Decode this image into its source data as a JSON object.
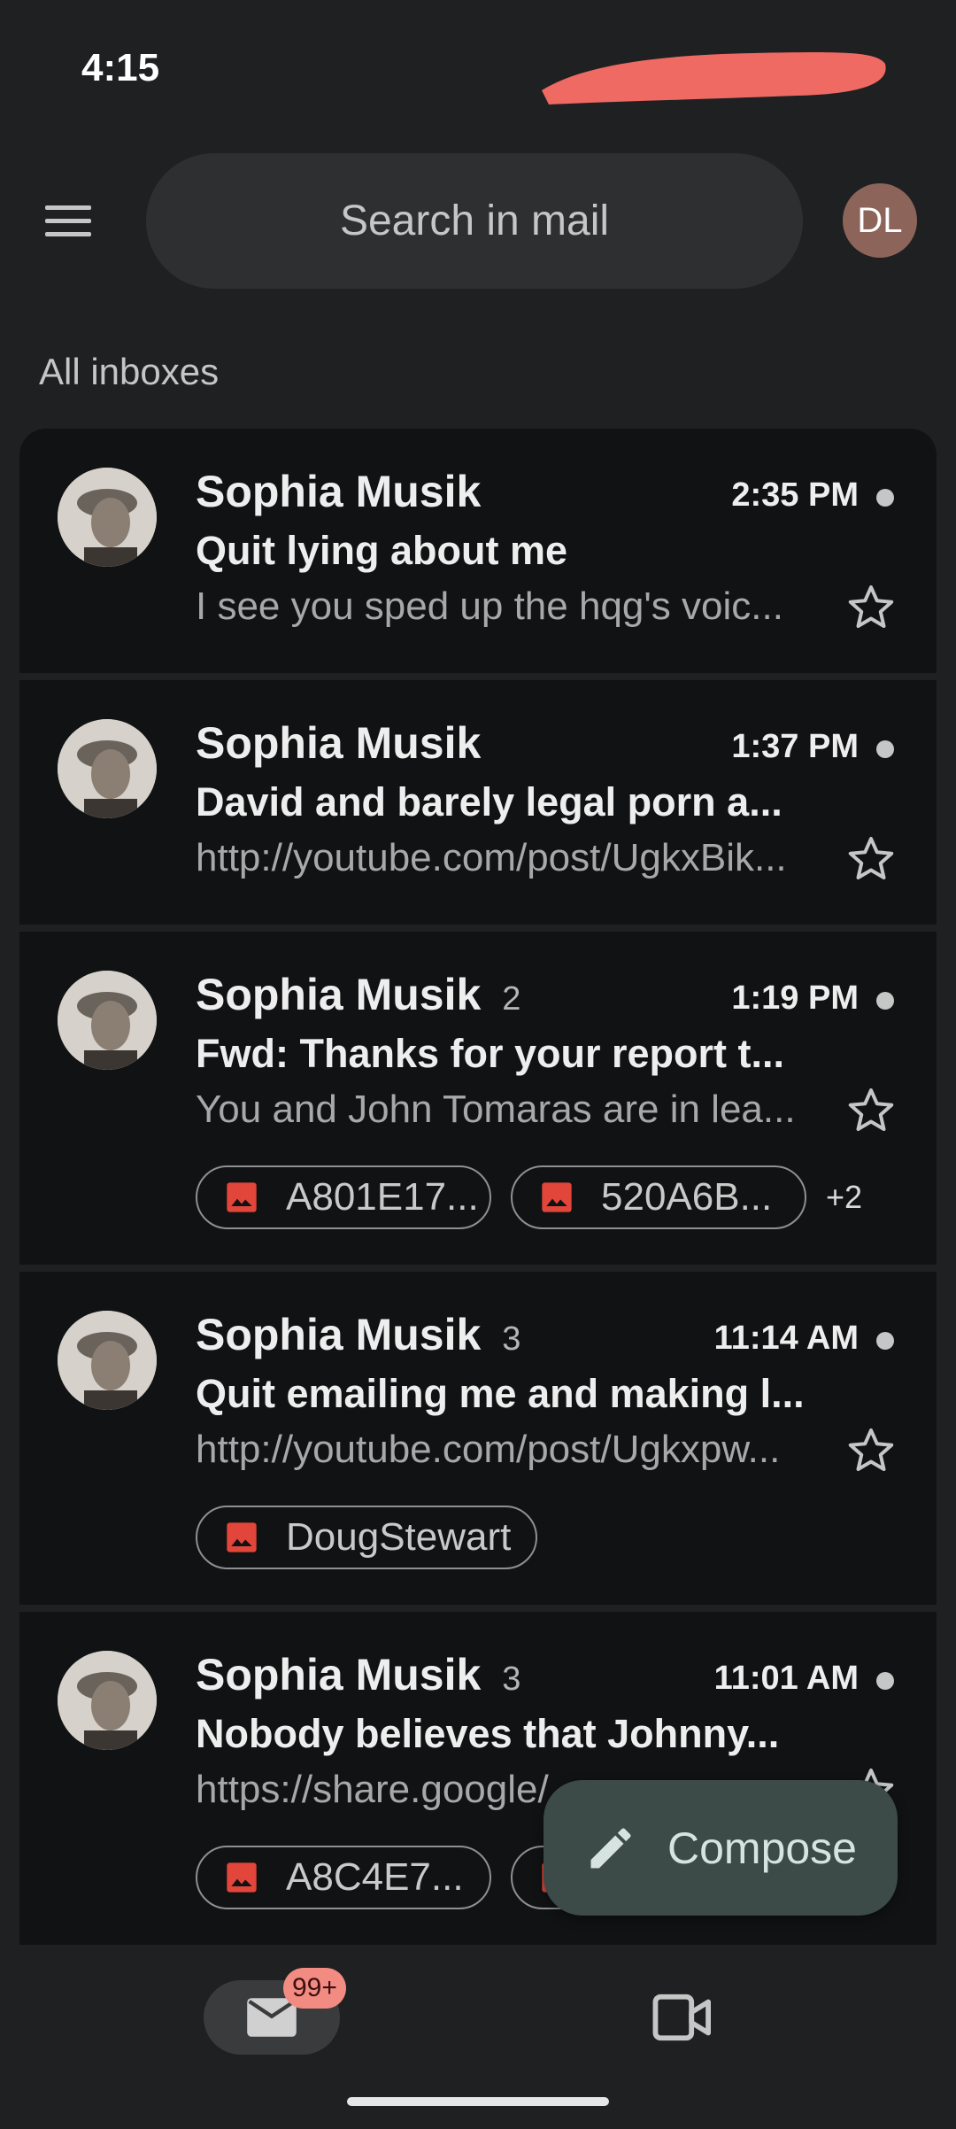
{
  "status_bar": {
    "time": "4:15"
  },
  "header": {
    "search_placeholder": "Search in mail",
    "avatar_initials": "DL"
  },
  "section_label": "All inboxes",
  "emails": [
    {
      "sender": "Sophia Musik",
      "count": "",
      "time": "2:35 PM",
      "subject": "Quit lying about me",
      "snippet": "I see you sped up the hqg's voic...",
      "unread": true,
      "starred": false,
      "attachments": [],
      "more": ""
    },
    {
      "sender": "Sophia Musik",
      "count": "",
      "time": "1:37 PM",
      "subject": "David and barely legal porn a...",
      "snippet": "http://youtube.com/post/UgkxBik...",
      "unread": true,
      "starred": false,
      "attachments": [],
      "more": ""
    },
    {
      "sender": "Sophia Musik",
      "count": "2",
      "time": "1:19 PM",
      "subject": "Fwd: Thanks for your report t...",
      "snippet": "You and John Tomaras are in lea...",
      "unread": true,
      "starred": false,
      "attachments": [
        "A801E17...",
        "520A6B..."
      ],
      "more": "+2"
    },
    {
      "sender": "Sophia Musik",
      "count": "3",
      "time": "11:14 AM",
      "subject": "Quit emailing me and making l...",
      "snippet": "http://youtube.com/post/Ugkxpw...",
      "unread": true,
      "starred": false,
      "attachments": [
        "DougStewart"
      ],
      "more": ""
    },
    {
      "sender": "Sophia Musik",
      "count": "3",
      "time": "11:01 AM",
      "subject": "Nobody believes that Johnny...",
      "snippet": "https://share.google/",
      "unread": true,
      "starred": false,
      "attachments": [
        "A8C4E7...",
        ""
      ],
      "more": ""
    }
  ],
  "compose": {
    "label": "Compose"
  },
  "bottom_nav": {
    "mail_badge": "99+"
  },
  "colors": {
    "background": "#1f2022",
    "card": "#111213",
    "redaction": "#ee6a62",
    "attachment_icon": "#e2463a",
    "compose_fab": "#3c4a48",
    "badge": "#f28b82"
  },
  "icons": {
    "menu": "menu-icon",
    "star": "star-outline-icon",
    "attachment": "image-icon",
    "compose": "pencil-icon",
    "mail": "mail-icon",
    "meet": "video-icon"
  }
}
